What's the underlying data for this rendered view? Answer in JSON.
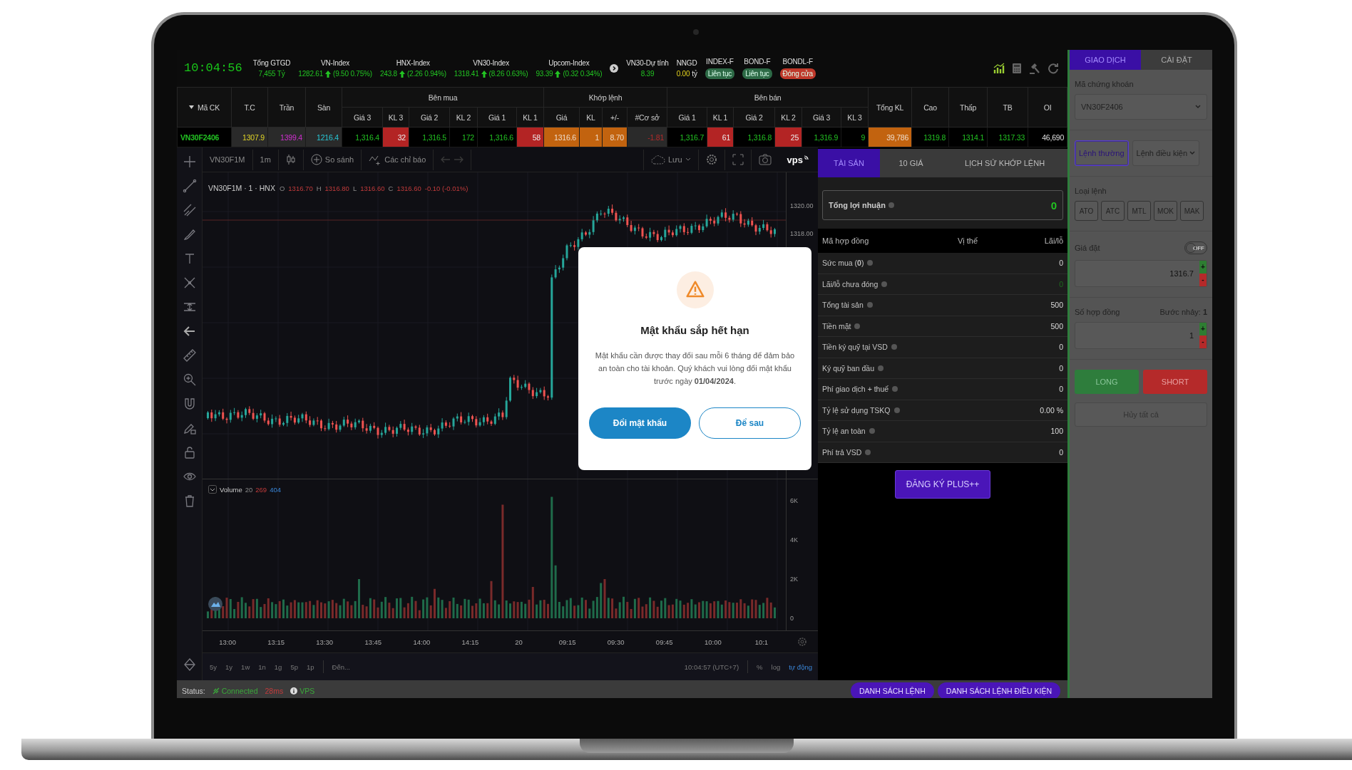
{
  "clock": "10:04:56",
  "indices": [
    {
      "kind": "total",
      "label": "Tổng GTGD",
      "value": "7,455 Tỷ"
    },
    {
      "kind": "index",
      "label": "VN-Index",
      "value": "1282.61",
      "rising": true,
      "change": "(9.50 0.75%)"
    },
    {
      "kind": "index",
      "label": "HNX-Index",
      "value": "243.8",
      "rising": true,
      "change": "(2.26 0.94%)"
    },
    {
      "kind": "index",
      "label": "VN30-Index",
      "value": "1318.41",
      "rising": true,
      "change": "(8.26 0.63%)"
    },
    {
      "kind": "index",
      "label": "Upcom-Index",
      "value": "93.39",
      "rising": true,
      "change": "(0.32 0.34%)"
    }
  ],
  "market_info": [
    {
      "kind": "estimate",
      "label": "VN30-Dự tính",
      "value": "8.39"
    },
    {
      "kind": "amount",
      "label": "NNGD",
      "value": "0.00",
      "unit": "tỷ"
    },
    {
      "kind": "session",
      "label": "INDEX-F",
      "value": "Liên tục",
      "open": true
    },
    {
      "kind": "session",
      "label": "BOND-F",
      "value": "Liên tục",
      "open": true
    },
    {
      "kind": "session",
      "label": "BONDL-F",
      "value": "Đóng cửa",
      "open": false
    }
  ],
  "table": {
    "leading_columns": [
      "Mã CK",
      "T.C",
      "Trần",
      "Sàn"
    ],
    "groups": [
      {
        "label": "Bên mua",
        "columns": [
          "Giá 3",
          "KL 3",
          "Giá 2",
          "KL 2",
          "Giá 1",
          "KL 1"
        ]
      },
      {
        "label": "Khớp lệnh",
        "columns": [
          "Giá",
          "KL",
          "+/-",
          "#Cơ sở"
        ]
      },
      {
        "label": "Bên bán",
        "columns": [
          "Giá 1",
          "KL 1",
          "Giá 2",
          "KL 2",
          "Giá 3",
          "KL 3"
        ]
      }
    ],
    "trailing_columns": [
      "Tổng KL",
      "Cao",
      "Thấp",
      "TB",
      "OI"
    ],
    "rows": [
      {
        "cells": [
          {
            "text": "VN30F2406",
            "kind": "symbol"
          },
          {
            "text": "1307.9",
            "kind": "reference"
          },
          {
            "text": "1399.4",
            "kind": "ceiling"
          },
          {
            "text": "1216.4",
            "kind": "floor"
          },
          {
            "text": "1,316.4",
            "kind": "up"
          },
          {
            "text": "32",
            "kind": "volume-box"
          },
          {
            "text": "1,316.5",
            "kind": "up"
          },
          {
            "text": "172",
            "kind": "up"
          },
          {
            "text": "1,316.6",
            "kind": "up"
          },
          {
            "text": "58",
            "kind": "volume-box"
          },
          {
            "text": "1316.6",
            "kind": "match"
          },
          {
            "text": "1",
            "kind": "match"
          },
          {
            "text": "8.70",
            "kind": "match"
          },
          {
            "text": "-1.81",
            "kind": "basis"
          },
          {
            "text": "1,316.7",
            "kind": "up"
          },
          {
            "text": "61",
            "kind": "volume-box"
          },
          {
            "text": "1,316.8",
            "kind": "up"
          },
          {
            "text": "25",
            "kind": "volume-box"
          },
          {
            "text": "1,316.9",
            "kind": "up"
          },
          {
            "text": "9",
            "kind": "up"
          },
          {
            "text": "39,786",
            "kind": "match"
          },
          {
            "text": "1319.8",
            "kind": "up"
          },
          {
            "text": "1314.1",
            "kind": "up"
          },
          {
            "text": "1317.33",
            "kind": "up"
          },
          {
            "text": "46,690",
            "kind": "plain"
          }
        ]
      }
    ]
  },
  "chart": {
    "toolbar": {
      "symbol": "VN30F1M",
      "interval": "1m",
      "compare": "So sánh",
      "indicators": "Các chỉ báo",
      "save": "Lưu",
      "brand": "vps"
    },
    "legend": {
      "title": "VN30F1M · 1 · HNX",
      "ohlc": [
        {
          "key": "O",
          "value": "1316.70"
        },
        {
          "key": "H",
          "value": "1316.80"
        },
        {
          "key": "L",
          "value": "1316.60"
        },
        {
          "key": "C",
          "value": "1316.60"
        }
      ],
      "change": "-0.10 (-0.01%)"
    },
    "price_axis": [
      "1320.00",
      "1318.00"
    ],
    "volume_legend": {
      "label": "Volume",
      "period": "20",
      "down": "269",
      "up": "404"
    },
    "volume_axis": [
      "6K",
      "4K",
      "2K",
      "0"
    ],
    "time_axis": [
      "13:00",
      "13:15",
      "13:30",
      "13:45",
      "14:00",
      "14:15",
      "20",
      "09:15",
      "09:30",
      "09:45",
      "10:00",
      "10:1"
    ],
    "ranges": [
      "5y",
      "1y",
      "1w",
      "1n",
      "1g",
      "5p",
      "1p"
    ],
    "goto": "Đến...",
    "clock": "10:04:57 (UTC+7)",
    "scale_options": [
      {
        "label": "%",
        "selected": false
      },
      {
        "label": "log",
        "selected": false
      },
      {
        "label": "tự động",
        "selected": true
      }
    ]
  },
  "modal": {
    "title": "Mật khẩu sắp hết hạn",
    "message": "Mật khẩu cần được thay đổi sau mỗi 6 tháng để đảm bảo an toàn cho tài khoản. Quý khách vui lòng đổi mật khẩu trước ngày **01/04/2024**.",
    "buttons": [
      {
        "label": "Đổi mật khẩu",
        "kind": "primary"
      },
      {
        "label": "Để sau",
        "kind": "secondary"
      }
    ]
  },
  "assets": {
    "tabs": [
      {
        "label": "TÀI SẢN",
        "selected": true
      },
      {
        "label": "10 GIÁ",
        "selected": false
      },
      {
        "label": "LỊCH SỬ KHỚP LỆNH",
        "selected": false
      }
    ],
    "total_profit": {
      "label": "Tổng lợi nhuận",
      "value": "0"
    },
    "columns": [
      "Mã hợp đồng",
      "Vị thế",
      "Lãi/lỗ"
    ],
    "rows": [
      {
        "label": "Sức mua (**0**)",
        "value": "0",
        "kind": "plain"
      },
      {
        "label": "Lãi/lỗ chưa đóng",
        "value": "0",
        "kind": "profit"
      },
      {
        "label": "Tổng tài sản",
        "value": "500",
        "kind": "plain"
      },
      {
        "label": "Tiền mặt",
        "value": "500",
        "kind": "plain"
      },
      {
        "label": "Tiền ký quỹ tại VSD",
        "value": "0",
        "kind": "plain"
      },
      {
        "label": "Ký quỹ ban đầu",
        "value": "0",
        "kind": "plain"
      },
      {
        "label": "Phí giao dịch + thuế",
        "value": "0",
        "kind": "plain"
      },
      {
        "label": "Tỷ lệ sử dụng TSKQ",
        "value": "0.00 %",
        "kind": "plain"
      },
      {
        "label": "Tỷ lệ an toàn",
        "value": "100",
        "kind": "plain"
      },
      {
        "label": "Phí trả VSD",
        "value": "0",
        "kind": "plain"
      }
    ],
    "register_button": "ĐĂNG KÝ PLUS++"
  },
  "status_bar": {
    "label": "Status:",
    "connection": "Connected",
    "latency": "28ms",
    "server": "VPS",
    "buttons": [
      "DANH SÁCH LỆNH",
      "DANH SÁCH LỆNH ĐIỀU KIỆN"
    ]
  },
  "order": {
    "tabs": [
      {
        "label": "GIAO DỊCH",
        "selected": true
      },
      {
        "label": "CÀI ĐẶT",
        "selected": false
      }
    ],
    "symbol_label": "Mã chứng khoán",
    "symbol": "VN30F2406",
    "modes": [
      {
        "label": "Lệnh thường",
        "kind": "button",
        "selected": true
      },
      {
        "label": "Lệnh điều kiện",
        "kind": "dropdown",
        "selected": false
      }
    ],
    "type_label": "Loại lệnh",
    "types": [
      {
        "label": "ATO",
        "selected": false
      },
      {
        "label": "ATC",
        "selected": false
      },
      {
        "label": "MTL",
        "selected": false
      },
      {
        "label": "MOK",
        "selected": false
      },
      {
        "label": "MAK",
        "selected": false
      }
    ],
    "price_label": "Giá đặt",
    "price_toggle": {
      "on": false,
      "label": "OFF"
    },
    "price": {
      "value": "1316.7",
      "increment": "+",
      "decrement": "-"
    },
    "quantity_label": "Số hợp đồng",
    "step": "Bước nhảy: **1**",
    "quantity": {
      "value": "1",
      "increment": "+",
      "decrement": "-"
    },
    "long": "LONG",
    "short": "SHORT",
    "cancel_all": "Hủy tất cả"
  }
}
